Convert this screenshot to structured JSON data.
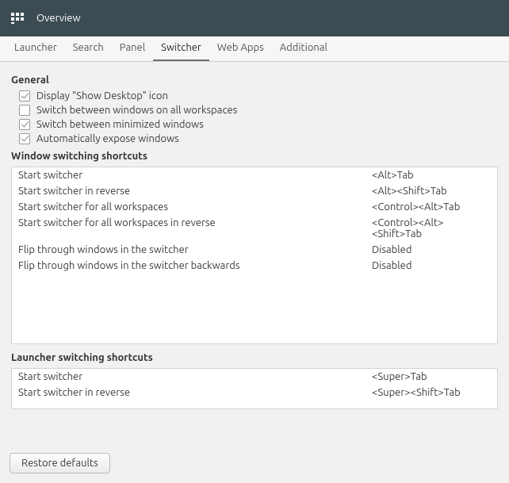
{
  "header": {
    "title": "Overview"
  },
  "tabs": [
    {
      "label": "Launcher"
    },
    {
      "label": "Search"
    },
    {
      "label": "Panel"
    },
    {
      "label": "Switcher"
    },
    {
      "label": "Web Apps"
    },
    {
      "label": "Additional"
    }
  ],
  "active_tab_index": 3,
  "general": {
    "title": "General",
    "items": [
      {
        "label": "Display \"Show Desktop\" icon",
        "checked": true
      },
      {
        "label": "Switch between windows on all workspaces",
        "checked": false
      },
      {
        "label": "Switch between minimized windows",
        "checked": true
      },
      {
        "label": "Automatically expose windows",
        "checked": true
      }
    ]
  },
  "window_shortcuts": {
    "title": "Window switching shortcuts",
    "rows": [
      {
        "label": "Start switcher",
        "value": "<Alt>Tab"
      },
      {
        "label": "Start switcher in reverse",
        "value": "<Alt><Shift>Tab"
      },
      {
        "label": "Start switcher for all workspaces",
        "value": "<Control><Alt>Tab"
      },
      {
        "label": "Start switcher for all workspaces in reverse",
        "value": "<Control><Alt><Shift>Tab"
      },
      {
        "label": "Flip through windows in the switcher",
        "value": "Disabled"
      },
      {
        "label": "Flip through windows in the switcher backwards",
        "value": "Disabled"
      }
    ]
  },
  "launcher_shortcuts": {
    "title": "Launcher switching shortcuts",
    "rows": [
      {
        "label": "Start switcher",
        "value": "<Super>Tab"
      },
      {
        "label": "Start switcher in reverse",
        "value": "<Super><Shift>Tab"
      }
    ]
  },
  "footer": {
    "restore_label": "Restore defaults"
  }
}
